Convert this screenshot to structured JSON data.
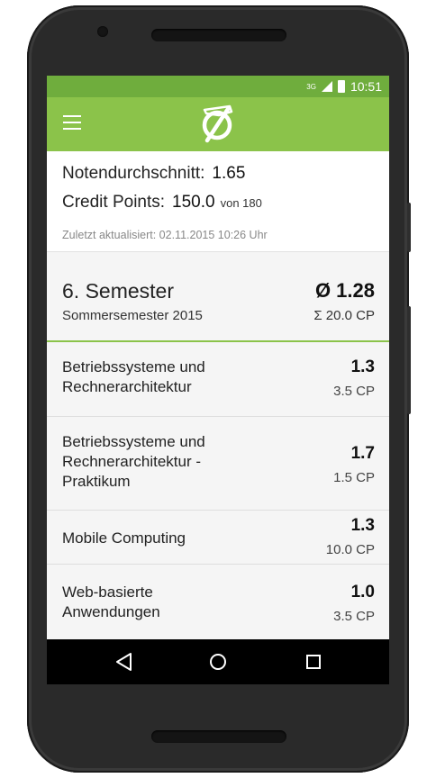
{
  "status_bar": {
    "network": "3G",
    "time": "10:51"
  },
  "app_bar": {
    "menu_icon": "hamburger-menu-icon",
    "logo_icon": "grade-average-logo-icon"
  },
  "summary": {
    "average_label": "Notendurchschnitt:",
    "average_value": "1.65",
    "credits_label": "Credit Points:",
    "credits_value": "150.0",
    "credits_total": "von 180",
    "updated": "Zuletzt aktualisiert:  02.11.2015 10:26 Uhr"
  },
  "semester": {
    "title": "6. Semester",
    "subtitle": "Sommersemester 2015",
    "average": "Ø 1.28",
    "credits": "Σ 20.0 CP"
  },
  "courses": [
    {
      "name": "Betriebssysteme und\nRechnerarchitektur",
      "grade": "1.3",
      "cp": "3.5 CP"
    },
    {
      "name": "Betriebssysteme und\nRechnerarchitektur -\nPraktikum",
      "grade": "1.7",
      "cp": "1.5 CP"
    },
    {
      "name": "Mobile Computing",
      "grade": "1.3",
      "cp": "10.0 CP"
    },
    {
      "name": "Web-basierte\nAnwendungen",
      "grade": "1.0",
      "cp": "3.5 CP"
    }
  ],
  "nav_bar": {
    "back_icon": "back-triangle-icon",
    "home_icon": "home-circle-icon",
    "recents_icon": "recents-square-icon"
  },
  "colors": {
    "status_bar": "#6fad3d",
    "app_bar": "#8bc34a",
    "accent": "#8bc34a"
  }
}
